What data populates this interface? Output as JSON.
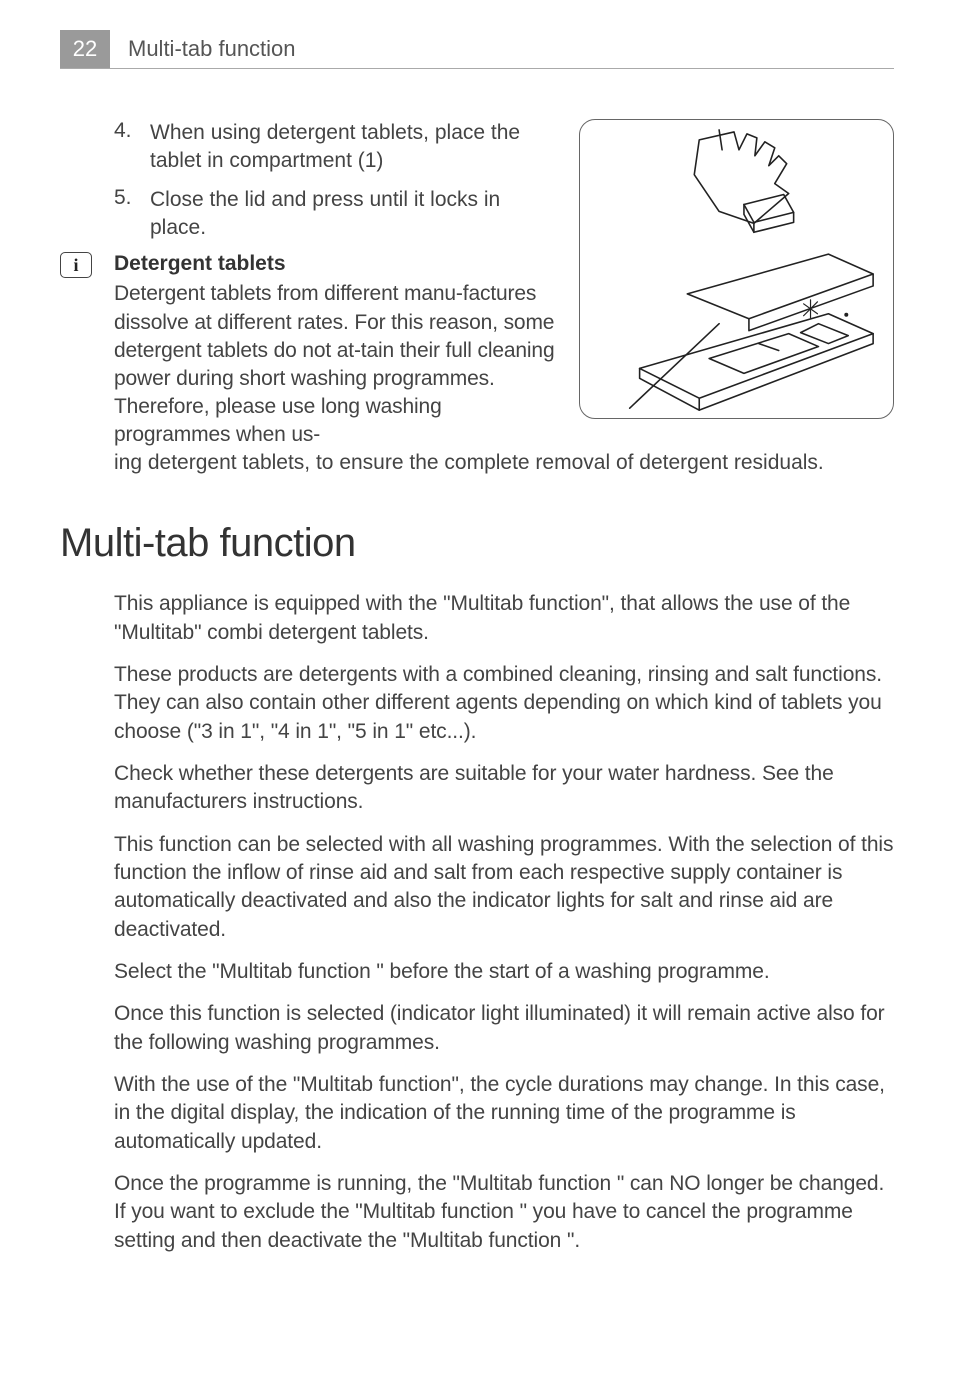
{
  "header": {
    "page_number": "22",
    "running_title": "Multi-tab function"
  },
  "steps": [
    {
      "num": "4.",
      "text": "When using detergent tablets, place the tablet in compartment (1)"
    },
    {
      "num": "5.",
      "text": "Close the lid and press until it locks in place."
    }
  ],
  "info": {
    "icon_glyph": "i",
    "heading": "Detergent tablets",
    "para_wrapped": "Detergent tablets from different manu-factures dissolve at different rates. For this reason, some detergent tablets do not at-tain their full cleaning power during short washing programmes. Therefore, please use long washing programmes when us-",
    "para_continuation": "ing detergent tablets, to ensure the complete removal of detergent residuals."
  },
  "section": {
    "heading": "Multi-tab function",
    "paragraphs": [
      "This appliance is equipped with the \"Multitab function\", that allows the use of the \"Multitab\" combi detergent tablets.",
      "These products are detergents with a combined cleaning, rinsing and salt functions. They can also contain other different agents depending on which kind of tablets you choose (\"3 in 1\", \"4 in 1\", \"5 in 1\" etc...).",
      "Check whether these detergents are suitable for your water hardness. See the manufacturers instructions.",
      "This function can be selected with all washing programmes. With the selection of this function the inflow of rinse aid and salt from each respective supply container is automatically deactivated and also the indicator lights for salt and rinse aid are deactivated.",
      "Select the \"Multitab function \" before the start of a washing programme.",
      "Once this function is selected (indicator light illuminated) it will remain active also for the following washing programmes.",
      "With the use of the \"Multitab function\", the cycle durations may change. In this case, in the digital display, the indication of the running time of the programme is automatically updated.",
      "Once the programme is running, the \"Multitab function \" can NO longer be changed. If you want to exclude the \"Multitab function \" you have to cancel the programme setting and then deactivate the \"Multitab function \"."
    ]
  }
}
